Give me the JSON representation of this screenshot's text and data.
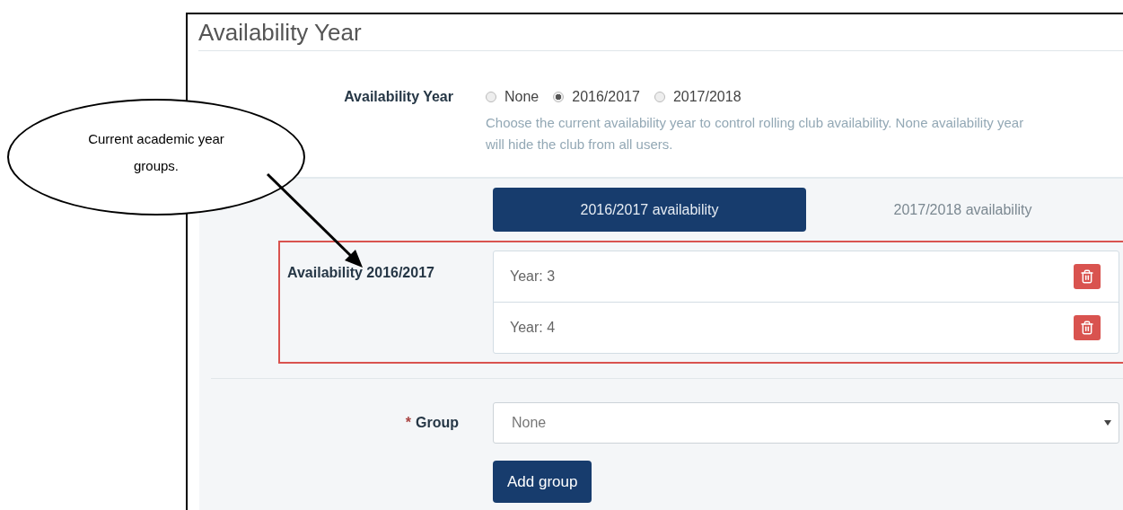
{
  "section": {
    "title": "Availability Year"
  },
  "availability_year": {
    "label": "Availability Year",
    "options": [
      {
        "label": "None",
        "selected": false
      },
      {
        "label": "2016/2017",
        "selected": true
      },
      {
        "label": "2017/2018",
        "selected": false
      }
    ],
    "help": "Choose the current availability year to control rolling club availability. None availability year will hide the club from all users."
  },
  "tabs": [
    {
      "label": "2016/2017 availability",
      "selected": true
    },
    {
      "label": "2017/2018 availability",
      "selected": false
    }
  ],
  "availability_list": {
    "label": "Availability 2016/2017",
    "items": [
      {
        "label": "Year: 3"
      },
      {
        "label": "Year: 4"
      }
    ]
  },
  "group_field": {
    "required_mark": "*",
    "label": "Group",
    "value": "None"
  },
  "add_button": {
    "label": "Add group"
  },
  "callout": {
    "text": "Current academic year groups."
  }
}
